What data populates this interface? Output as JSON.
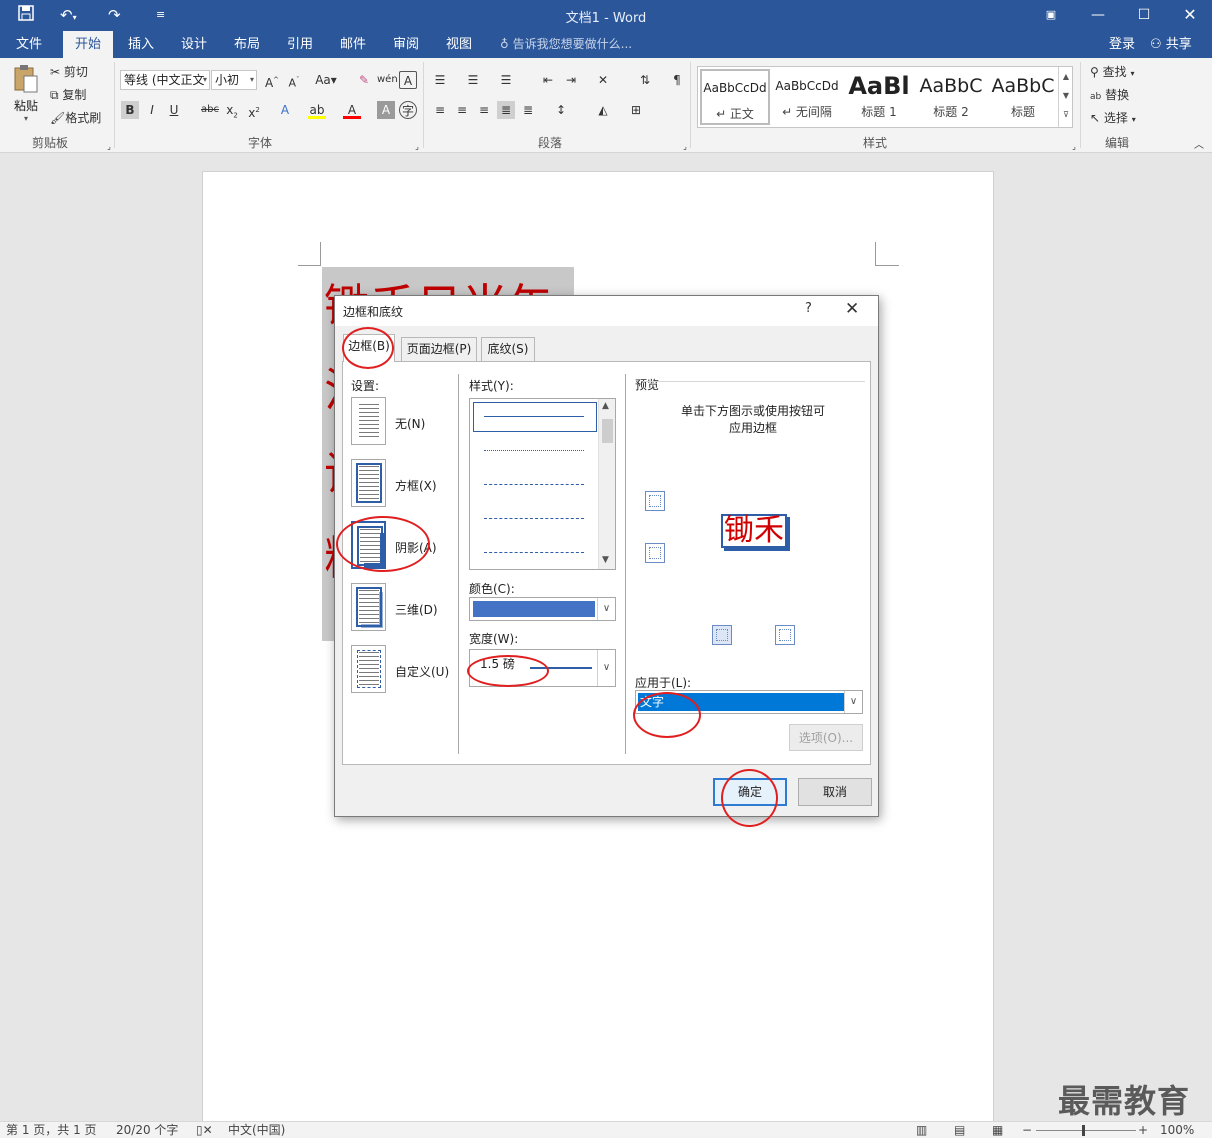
{
  "window": {
    "title": "文档1 - Word",
    "quick_access": [
      "save-icon",
      "undo-icon",
      "redo-icon",
      "customize-icon"
    ]
  },
  "tabs": [
    "文件",
    "开始",
    "插入",
    "设计",
    "布局",
    "引用",
    "邮件",
    "审阅",
    "视图"
  ],
  "active_tab": "开始",
  "tell_me": "告诉我您想要做什么...",
  "account": {
    "login": "登录",
    "share": "共享"
  },
  "ribbon": {
    "clipboard": {
      "paste": "粘贴",
      "cut": "剪切",
      "copy": "复制",
      "format_painter": "格式刷",
      "label": "剪贴板"
    },
    "font": {
      "font_name": "等线 (中文正文",
      "font_size": "小初",
      "label": "字体"
    },
    "paragraph": {
      "label": "段落"
    },
    "styles": {
      "label": "样式",
      "items": [
        {
          "preview": "AaBbCcDd",
          "name": "↵ 正文"
        },
        {
          "preview": "AaBbCcDd",
          "name": "↵ 无间隔"
        },
        {
          "preview": "AaBl",
          "name": "标题 1"
        },
        {
          "preview": "AaBbC",
          "name": "标题 2"
        },
        {
          "preview": "AaBbC",
          "name": "标题"
        }
      ]
    },
    "editing": {
      "find": "查找",
      "replace": "替换",
      "select": "选择",
      "label": "编辑"
    }
  },
  "document": {
    "lines": [
      "锄禾日当午",
      "汗",
      "谁",
      "粒"
    ]
  },
  "dialog": {
    "title": "边框和底纹",
    "help": "?",
    "tabs": [
      "边框(B)",
      "页面边框(P)",
      "底纹(S)"
    ],
    "settings_label": "设置:",
    "settings": [
      "无(N)",
      "方框(X)",
      "阴影(A)",
      "三维(D)",
      "自定义(U)"
    ],
    "style_label": "样式(Y):",
    "color_label": "颜色(C):",
    "color_value": "#4472c4",
    "width_label": "宽度(W):",
    "width_value": "1.5 磅",
    "preview_label": "预览",
    "preview_hint": "单击下方图示或使用按钮可",
    "preview_hint2": "应用边框",
    "preview_sample": "锄禾",
    "apply_label": "应用于(L):",
    "apply_value": "文字",
    "options_button": "选项(O)...",
    "ok_button": "确定",
    "cancel_button": "取消"
  },
  "status": {
    "page": "第 1 页，共 1 页",
    "words": "20/20 个字",
    "language": "中文(中国)",
    "zoom": "100%"
  },
  "watermark": "最需教育"
}
